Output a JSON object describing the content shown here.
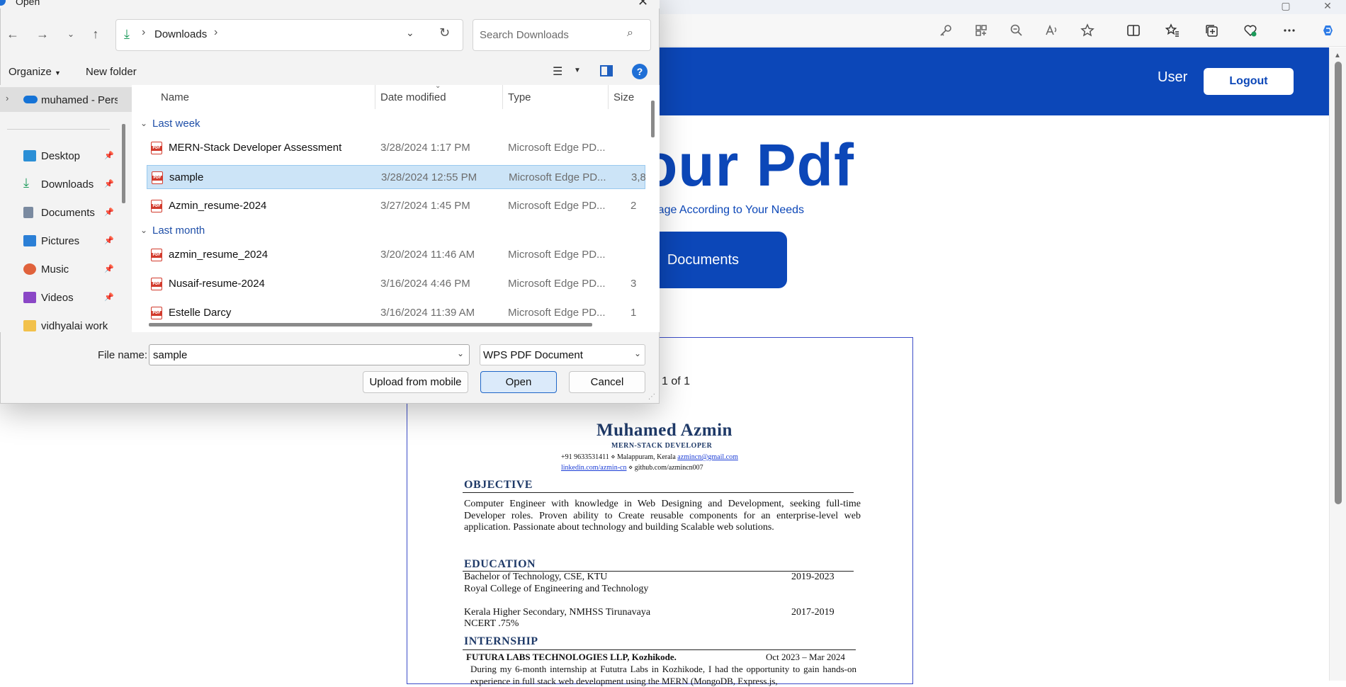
{
  "browser": {
    "toolbar_icons": [
      "key-icon",
      "apps-icon",
      "zoom-out-icon",
      "read-aloud-icon",
      "favorite-icon",
      "split-screen-icon",
      "favorites-icon",
      "collections-icon",
      "browser-essentials-icon",
      "more-icon",
      "copilot-icon"
    ]
  },
  "site": {
    "user_label": "User",
    "logout_label": "Logout",
    "hero_title": "our Pdf",
    "hero_subtitle": "Page According to Your Needs",
    "hero_button": "Documents",
    "brand_color": "#0c47b8"
  },
  "pdf_viewer": {
    "page_indicator": "1 of 1",
    "resume": {
      "name": "Muhamed Azmin",
      "role": "MERN-STACK DEVELOPER",
      "phone_location": "+91 9633531411 ⋄ Malappuram, Kerala",
      "email": "azmincn@gmail.com",
      "linkedin": "linkedin.com/azmin-cn",
      "github": "⋄ github.com/azmincn007",
      "sections": {
        "objective": {
          "title": "OBJECTIVE",
          "text": "Computer Engineer with knowledge in Web Designing and Development, seeking full-time Developer roles. Proven ability to Create reusable components for an enterprise-level web application. Passionate about technology and building Scalable web solutions."
        },
        "education": {
          "title": "EDUCATION",
          "entries": [
            {
              "line1": "Bachelor of Technology, CSE, KTU",
              "line2": "Royal College of Engineering and Technology",
              "years": "2019-2023"
            },
            {
              "line1": "Kerala Higher Secondary, NMHSS Tirunavaya",
              "line2": "NCERT .75%",
              "years": "2017-2019"
            }
          ]
        },
        "internship": {
          "title": "INTERNSHIP",
          "company": "FUTURA LABS TECHNOLOGIES LLP, Kozhikode.",
          "dates": "Oct 2023 – Mar 2024",
          "text": "During my 6-month internship at Fututra Labs in Kozhikode, I had the opportunity to gain hands-on experience in full stack web development using the MERN (MongoDB, Express.js,"
        }
      }
    }
  },
  "dialog": {
    "title": "Open",
    "address": {
      "location": "Downloads"
    },
    "search_placeholder": "Search Downloads",
    "commands": {
      "organize": "Organize",
      "new_folder": "New folder"
    },
    "nav": {
      "onedrive": "muhamed - Personal",
      "items": [
        {
          "label": "Desktop",
          "icon": "desktop-icon",
          "color": "#2b8fd6"
        },
        {
          "label": "Downloads",
          "icon": "download-icon",
          "color": "#1b9a5a"
        },
        {
          "label": "Documents",
          "icon": "documents-icon",
          "color": "#7a8aa0"
        },
        {
          "label": "Pictures",
          "icon": "pictures-icon",
          "color": "#2b7fd6"
        },
        {
          "label": "Music",
          "icon": "music-icon",
          "color": "#e0623c"
        },
        {
          "label": "Videos",
          "icon": "videos-icon",
          "color": "#8a47c6"
        },
        {
          "label": "vidhyalai work",
          "icon": "folder-icon",
          "color": "#f2c14b"
        }
      ]
    },
    "columns": {
      "name": "Name",
      "date": "Date modified",
      "type": "Type",
      "size": "Size"
    },
    "groups": [
      {
        "label": "Last week",
        "files": [
          {
            "name": "MERN-Stack Developer Assessment",
            "date": "3/28/2024 1:17 PM",
            "type": "Microsoft Edge PD...",
            "size": "",
            "selected": false
          },
          {
            "name": "sample",
            "date": "3/28/2024 12:55 PM",
            "type": "Microsoft Edge PD...",
            "size": "3,8",
            "selected": true
          },
          {
            "name": "Azmin_resume-2024",
            "date": "3/27/2024 1:45 PM",
            "type": "Microsoft Edge PD...",
            "size": "2",
            "selected": false
          }
        ]
      },
      {
        "label": "Last month",
        "files": [
          {
            "name": "azmin_resume_2024",
            "date": "3/20/2024 11:46 AM",
            "type": "Microsoft Edge PD...",
            "size": "",
            "selected": false
          },
          {
            "name": "Nusaif-resume-2024",
            "date": "3/16/2024 4:46 PM",
            "type": "Microsoft Edge PD...",
            "size": "3",
            "selected": false
          },
          {
            "name": "Estelle Darcy",
            "date": "3/16/2024 11:39 AM",
            "type": "Microsoft Edge PD...",
            "size": "1",
            "selected": false
          }
        ]
      }
    ],
    "file_name_label": "File name:",
    "file_name_value": "sample",
    "file_type_value": "WPS PDF Document",
    "buttons": {
      "upload_mobile": "Upload from mobile",
      "open": "Open",
      "cancel": "Cancel"
    }
  }
}
